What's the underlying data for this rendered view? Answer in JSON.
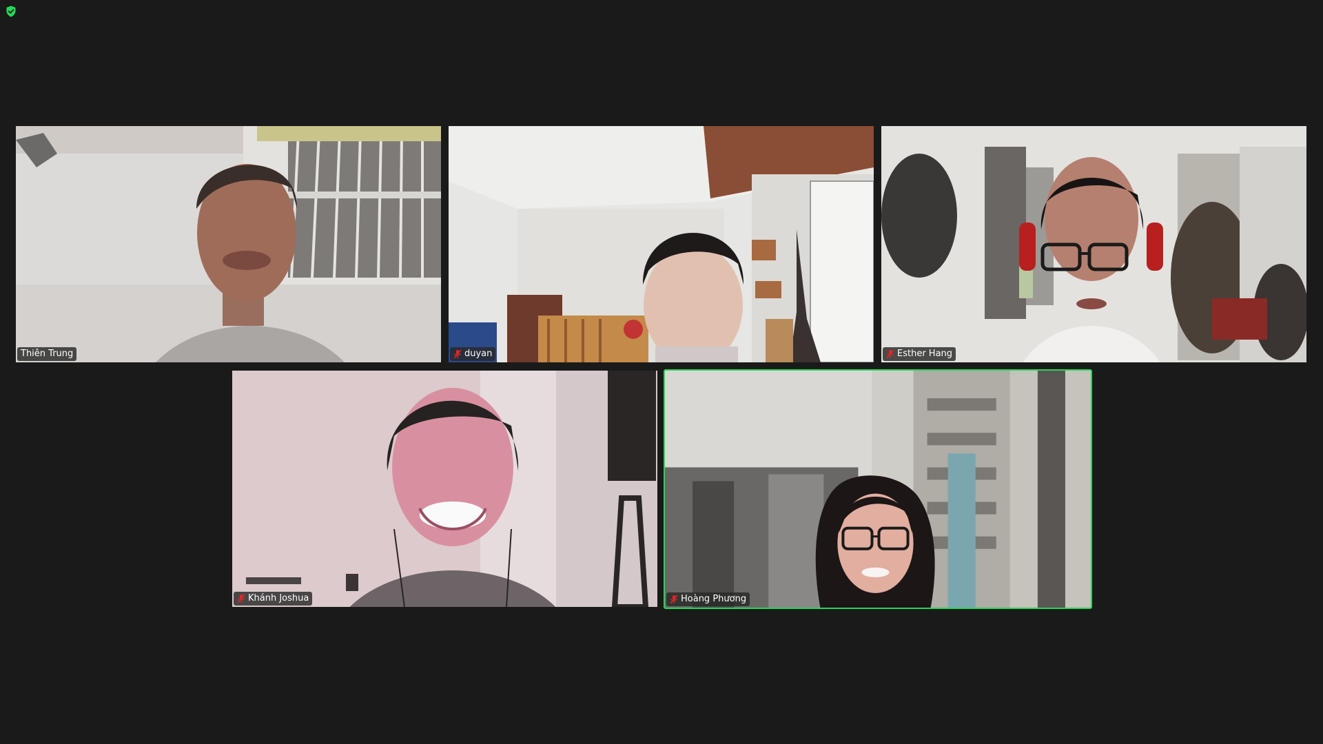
{
  "meeting": {
    "encryption_icon": "shield-check-icon",
    "encryption_color": "#23d959",
    "active_speaker_color": "#23d959",
    "background_color": "#1a1a1a"
  },
  "participants": [
    {
      "name": "Thiên Trung",
      "muted": false,
      "active_speaker": false
    },
    {
      "name": "duyan",
      "muted": true,
      "active_speaker": false
    },
    {
      "name": "Esther Hang",
      "muted": true,
      "active_speaker": false
    },
    {
      "name": "Khánh Joshua",
      "muted": true,
      "active_speaker": false
    },
    {
      "name": "Hoàng Phương",
      "muted": true,
      "active_speaker": true
    }
  ],
  "icons": {
    "muted_mic": "mic-muted-icon",
    "muted_color": "#e02828"
  }
}
